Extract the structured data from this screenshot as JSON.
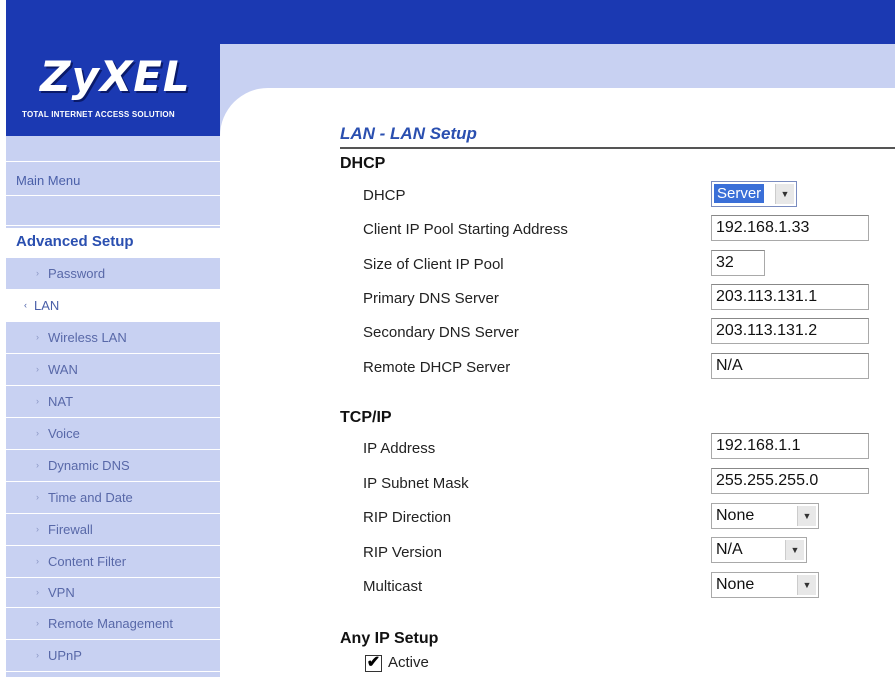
{
  "brand": {
    "logo": "ZyXEL",
    "tagline": "TOTAL INTERNET ACCESS SOLUTION"
  },
  "sidebar": {
    "main_menu": "Main Menu",
    "section": "Advanced Setup",
    "items": [
      {
        "label": "Password"
      },
      {
        "label": "LAN"
      },
      {
        "label": "Wireless LAN"
      },
      {
        "label": "WAN"
      },
      {
        "label": "NAT"
      },
      {
        "label": "Voice"
      },
      {
        "label": "Dynamic DNS"
      },
      {
        "label": "Time and Date"
      },
      {
        "label": "Firewall"
      },
      {
        "label": "Content Filter"
      },
      {
        "label": "VPN"
      },
      {
        "label": "Remote Management"
      },
      {
        "label": "UPnP"
      }
    ],
    "active": "LAN"
  },
  "page": {
    "title": "LAN - LAN Setup"
  },
  "dhcp": {
    "heading": "DHCP",
    "dhcp_label": "DHCP",
    "dhcp_value": "Server",
    "pool_start_label": "Client IP Pool Starting Address",
    "pool_start_value": "192.168.1.33",
    "pool_size_label": "Size of Client IP Pool",
    "pool_size_value": "32",
    "primary_dns_label": "Primary DNS Server",
    "primary_dns_value": "203.113.131.1",
    "secondary_dns_label": "Secondary DNS Server",
    "secondary_dns_value": "203.113.131.2",
    "remote_dhcp_label": "Remote DHCP Server",
    "remote_dhcp_value": "N/A"
  },
  "tcpip": {
    "heading": "TCP/IP",
    "ip_label": "IP Address",
    "ip_value": "192.168.1.1",
    "mask_label": "IP Subnet Mask",
    "mask_value": "255.255.255.0",
    "rip_dir_label": "RIP Direction",
    "rip_dir_value": "None",
    "rip_ver_label": "RIP Version",
    "rip_ver_value": "N/A",
    "multicast_label": "Multicast",
    "multicast_value": "None"
  },
  "any_ip": {
    "heading": "Any IP Setup",
    "active_label": "Active",
    "active_checked": true,
    "check_glyph": "✔"
  },
  "colors": {
    "brand_blue": "#1b39b2",
    "sidebar_bg": "#c8d1f2",
    "title_blue": "#2a4fb0"
  }
}
